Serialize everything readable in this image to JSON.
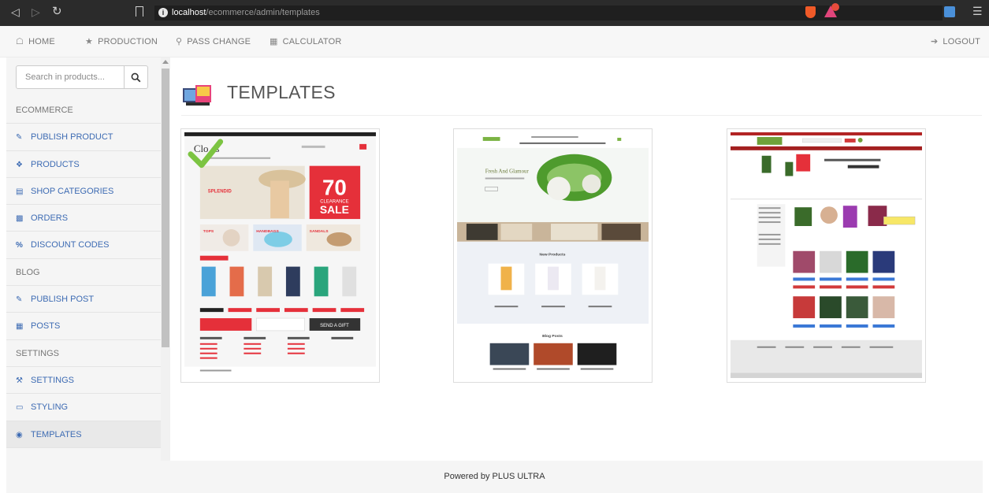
{
  "browser": {
    "url_host": "localhost",
    "url_path": "/ecommerce/admin/templates"
  },
  "topnav": {
    "home": "HOME",
    "production": "PRODUCTION",
    "pass_change": "PASS CHANGE",
    "calculator": "CALCULATOR",
    "logout": "LOGOUT"
  },
  "sidebar": {
    "search_placeholder": "Search in products...",
    "items": [
      {
        "label": "ECOMMERCE",
        "type": "heading"
      },
      {
        "label": "PUBLISH PRODUCT",
        "type": "link",
        "icon": "edit-icon"
      },
      {
        "label": "PRODUCTS",
        "type": "link",
        "icon": "products-icon"
      },
      {
        "label": "SHOP CATEGORIES",
        "type": "link",
        "icon": "list-icon"
      },
      {
        "label": "ORDERS",
        "type": "link",
        "icon": "orders-icon"
      },
      {
        "label": "DISCOUNT CODES",
        "type": "link",
        "icon": "percent-icon"
      },
      {
        "label": "BLOG",
        "type": "heading"
      },
      {
        "label": "PUBLISH POST",
        "type": "link",
        "icon": "edit-icon"
      },
      {
        "label": "POSTS",
        "type": "link",
        "icon": "grid-icon"
      },
      {
        "label": "SETTINGS",
        "type": "heading"
      },
      {
        "label": "SETTINGS",
        "type": "link",
        "icon": "wrench-icon"
      },
      {
        "label": "STYLING",
        "type": "link",
        "icon": "monitor-icon"
      },
      {
        "label": "TEMPLATES",
        "type": "link",
        "icon": "binoculars-icon",
        "active": true
      }
    ]
  },
  "main": {
    "title": "TEMPLATES",
    "templates": [
      {
        "selected": true,
        "mini": {
          "logo": "Clo  es",
          "sale_big": "70",
          "sale_mid": "CLEARANCE",
          "sale_small": "SALE",
          "splendid": "SPLENDID",
          "banner_1": "TOPS",
          "banner_2": "HANDBAGS",
          "banner_3": "SANDALS",
          "send_gift": "SEND A GIFT"
        }
      },
      {
        "selected": false,
        "mini": {
          "hero": "Fresh And Glamour",
          "section_1": "New Products",
          "section_2": "Blog Posts"
        }
      },
      {
        "selected": false,
        "mini": {}
      }
    ]
  },
  "colors": {
    "accent_red": "#e5303a",
    "link_blue": "#3d6bb3",
    "check_green": "#7cc442"
  },
  "footer": {
    "text": "Powered by PLUS ULTRA"
  }
}
